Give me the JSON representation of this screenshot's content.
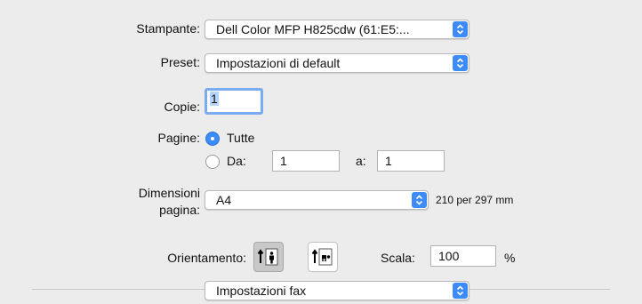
{
  "printer": {
    "label": "Stampante:",
    "value": "Dell Color MFP H825cdw (61:E5:..."
  },
  "preset": {
    "label": "Preset:",
    "value": "Impostazioni di default"
  },
  "copies": {
    "label": "Copie:",
    "value": "1"
  },
  "pages": {
    "label": "Pagine:",
    "all_label": "Tutte",
    "from_label": "Da:",
    "from_value": "1",
    "to_label": "a:",
    "to_value": "1"
  },
  "paper_size": {
    "label_line1": "Dimensioni",
    "label_line2": "pagina:",
    "value": "A4",
    "dimensions": "210 per 297 mm"
  },
  "orientation": {
    "label": "Orientamento:",
    "portrait_icon": "portrait-orientation-icon",
    "landscape_icon": "landscape-orientation-icon"
  },
  "scale": {
    "label": "Scala:",
    "value": "100",
    "unit": "%"
  },
  "section": {
    "value": "Impostazioni fax"
  },
  "colors": {
    "accent": "#3d8bf7",
    "background": "#ececec"
  }
}
